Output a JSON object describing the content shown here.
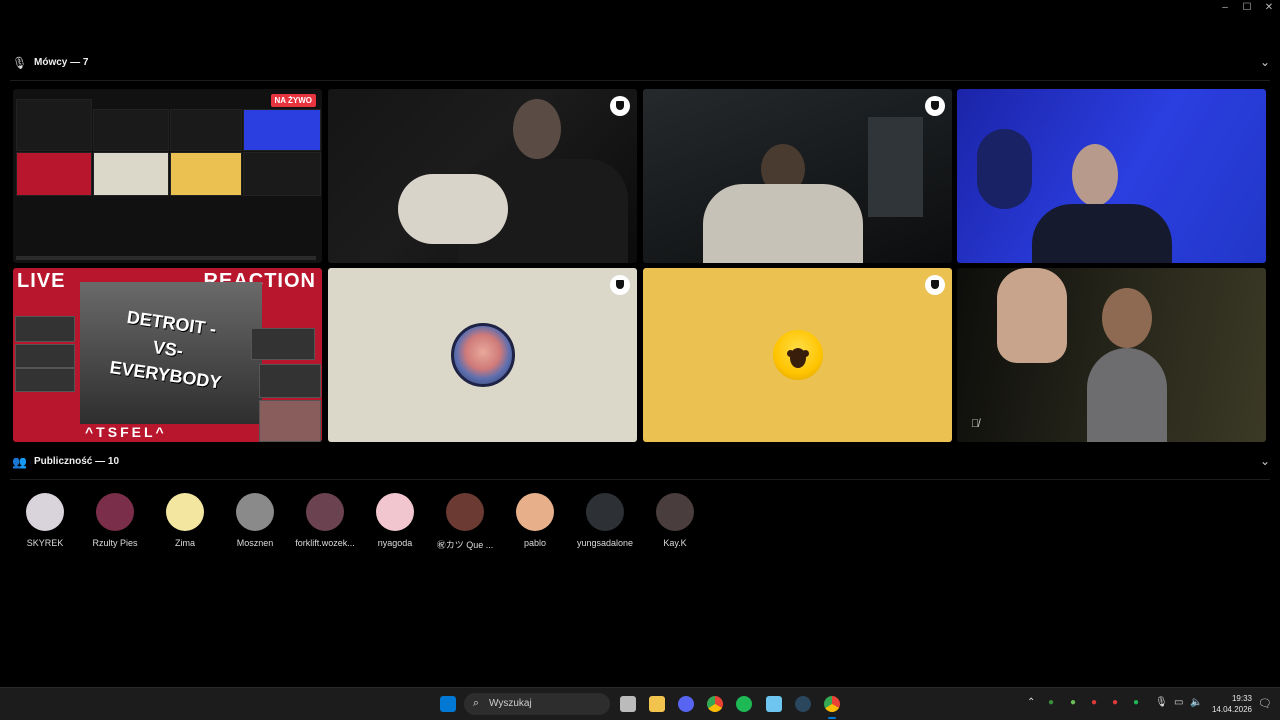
{
  "window": {
    "minimize": "–",
    "maximize": "☐",
    "close": "✕"
  },
  "speakers": {
    "title": "Mówcy — 7",
    "chevron": "⌄"
  },
  "stage": {
    "live_badge": "NA ŻYWO",
    "tile5_live": "LIVE",
    "tile5_reaction": "REACTION",
    "tile5_poster": "DETROIT -VS- EVERYBODY",
    "tile5_signature": "^TSFEL^"
  },
  "audience": {
    "title": "Publiczność — 10",
    "chevron": "⌄",
    "members": [
      {
        "name": "SKYREK",
        "color": "#d9d3dc"
      },
      {
        "name": "Rzulty Pies",
        "color": "#7a2e4a"
      },
      {
        "name": "Zima",
        "color": "#f2e6a0"
      },
      {
        "name": "Mosznen",
        "color": "#8a8a8a"
      },
      {
        "name": "forklift.wozek...",
        "color": "#6b4250"
      },
      {
        "name": "nyagoda",
        "color": "#f1c6cf"
      },
      {
        "name": "㊗カツ Que ...",
        "color": "#6b3a33"
      },
      {
        "name": "pablo",
        "color": "#e8b08a"
      },
      {
        "name": "yungsadalone",
        "color": "#2d3136"
      },
      {
        "name": "Kay.K",
        "color": "#4a3d3d"
      }
    ]
  },
  "taskbar": {
    "search_placeholder": "Wyszukaj",
    "time": "19:33",
    "date": "14.04.2026",
    "apps": [
      "windows-start",
      "task-view",
      "file-explorer",
      "discord",
      "chrome",
      "spotify",
      "notepad",
      "steam",
      "chrome-alt"
    ],
    "accent": "#0078d4"
  }
}
